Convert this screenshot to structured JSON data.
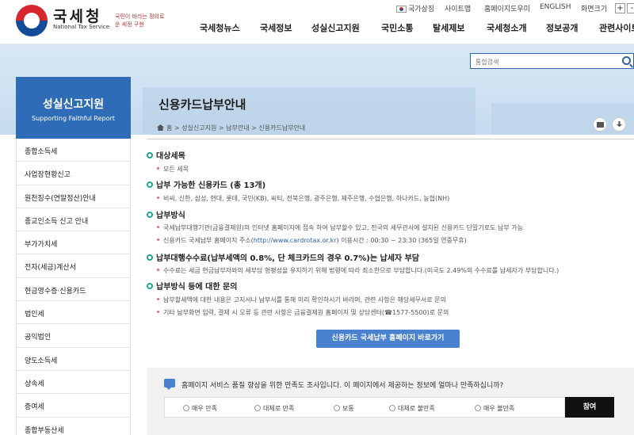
{
  "util": {
    "gov_label": "국가상징",
    "links": [
      "사이트맵",
      "홈페이지도우미",
      "ENGLISH",
      "화면크기"
    ],
    "zoom_in": "+",
    "zoom_out": "-"
  },
  "header": {
    "logo_kor": "국세청",
    "logo_eng": "National Tax Service",
    "slogan": "국민이 바라는 정의로운 세정 구현",
    "nav": [
      "국세청뉴스",
      "국세정보",
      "성실신고지원",
      "국민소통",
      "탈세제보",
      "국세청소개",
      "정보공개",
      "관련사이트"
    ]
  },
  "search": {
    "placeholder": "통합검색"
  },
  "sidebar": {
    "title": "성실신고지원",
    "subtitle": "Supporting Faithful Report",
    "items": [
      "종합소득세",
      "사업장현황신고",
      "원천징수(연말정산)안내",
      "종교인소득 신고 안내",
      "부가가치세",
      "전자(세금)계산서",
      "현금영수증·신용카드",
      "법인세",
      "공익법인",
      "양도소득세",
      "상속세",
      "증여세",
      "종합부동산세"
    ]
  },
  "page": {
    "title": "신용카드납부안내",
    "breadcrumb": [
      "홈",
      "성실신고지원",
      "납부안내",
      "신용카드납부안내"
    ]
  },
  "sections": [
    {
      "title": "대상세목",
      "bullets": [
        "모든 세목"
      ]
    },
    {
      "title": "납부 가능한 신용카드 (총 13개)",
      "bullets": [
        "비씨, 신한, 삼성, 현대, 롯데, 국민(KB), 씨티, 전북은행, 광주은행, 제주은행, 수협은행, 하나카드, 농협(NH)"
      ]
    },
    {
      "title": "납부방식",
      "bullets": [
        "국세납부대행기관(금융결제원)의 인터넷 홈페이지에 접속 하여 납부할수 있고, 전국의 세무관서에 설치된 신용카드 단말기로도 납부 가능"
      ]
    },
    {
      "title": "납부대행수수료(납부세액의 0.8%, 단 체크카드의 경우 0.7%)는 납세자 부담",
      "bullets": [
        "수수료는 세금 현금납부자와의 세부담 형평성을 유지하기 위해 법령에 따라 최소한으로 부담합니다.(미국도 2.49%의 수수료를 납세자가 부담합니다.)"
      ]
    },
    {
      "title": "납부방식 등에 대한 문의",
      "bullets": [
        "납부할세액에 대한 내용은 고지서나 납부서를 통해 미리 확인하시기 바라며, 관련 사항은 해당세무서로 문의",
        "기타 납부화면 입력, 결제 시 오류 등 관련 사항은 금융결제원 홈페이지 및 상담센터(☎1577-5500)로 문의"
      ]
    }
  ],
  "cardrotax": {
    "prefix": "신용카드 국세납부 홈페이지 주소(",
    "url": "http://www.cardrotax.or.kr",
    "suffix": ") 이용시간 : 00:30 ~ 23:30 (365일 연중무휴)"
  },
  "cta_label": "신용카드 국세납부 홈페이지 바로가기",
  "survey": {
    "question": "홈페이지 서비스 품질 향상을 위한 만족도 조사입니다. 이 페이지에서 제공하는 정보에 얼마나 만족하십니까?",
    "options": [
      "매우 만족",
      "대체로 만족",
      "보통",
      "대체로 불만족",
      "매우 불만족"
    ],
    "submit": "참여"
  }
}
